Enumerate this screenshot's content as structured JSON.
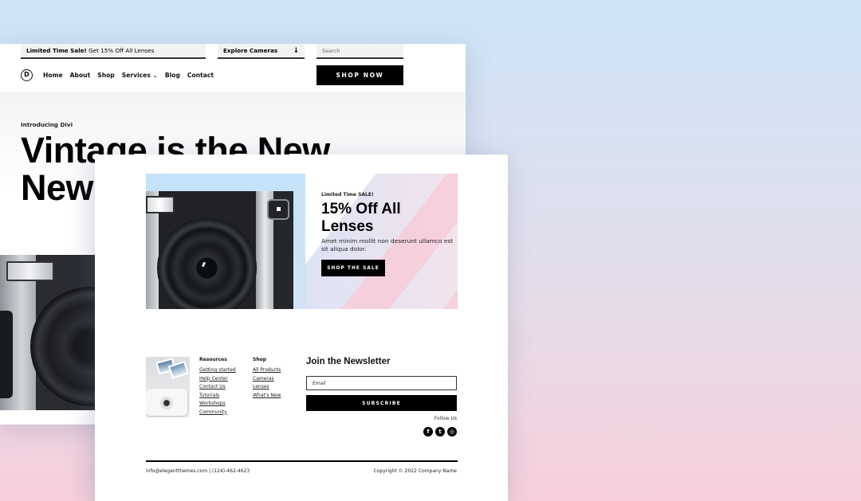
{
  "back_page": {
    "topbar": {
      "promo_bold": "Limited Time Sale!",
      "promo_text": " Get 15% Off All Lenses",
      "explore_label": "Explore Cameras",
      "explore_icon": "arrow-down-icon",
      "search_placeholder": "Search"
    },
    "logo_letter": "D",
    "nav": [
      {
        "label": "Home"
      },
      {
        "label": "About"
      },
      {
        "label": "Shop"
      },
      {
        "label": "Services ⌄"
      },
      {
        "label": "Blog"
      },
      {
        "label": "Contact"
      }
    ],
    "shop_now_label": "SHOP NOW",
    "intro": "Introducing Divi",
    "headline_line1": "Vintage is the New",
    "headline_line2": "New"
  },
  "front_page": {
    "banner": {
      "eyebrow": "Limited Time SALE!",
      "title": "15% Off All Lenses",
      "description": "Amet minim mollit non deserunt ullamco est sit aliqua dolor.",
      "cta_label": "SHOP THE SALE"
    },
    "footer": {
      "resources": {
        "heading": "Resources",
        "links": [
          "Getting started",
          "Help Center",
          "Contact Us",
          "Tutorials",
          "Workshops",
          "Community"
        ]
      },
      "shop": {
        "heading": "Shop",
        "links": [
          "All Products",
          "Cameras",
          "Lenses",
          "What's New"
        ]
      },
      "newsletter": {
        "title": "Join the Newsletter",
        "email_placeholder": "Email",
        "subscribe_label": "SUBSCRIBE",
        "follow_label": "Follow Us",
        "socials": [
          {
            "icon": "facebook-icon",
            "glyph": "f"
          },
          {
            "icon": "twitter-icon",
            "glyph": "t"
          },
          {
            "icon": "instagram-icon",
            "glyph": "◎"
          }
        ]
      },
      "contact": "info@elegantthemes.com  |  (124)-462-4623",
      "copyright": "Copyright © 2022 Company Name"
    }
  },
  "colors": {
    "bg_top": "#cde5f8",
    "bg_bottom": "#f6cfdb",
    "accent_pink": "#f6cdd9",
    "button_black": "#000000"
  }
}
